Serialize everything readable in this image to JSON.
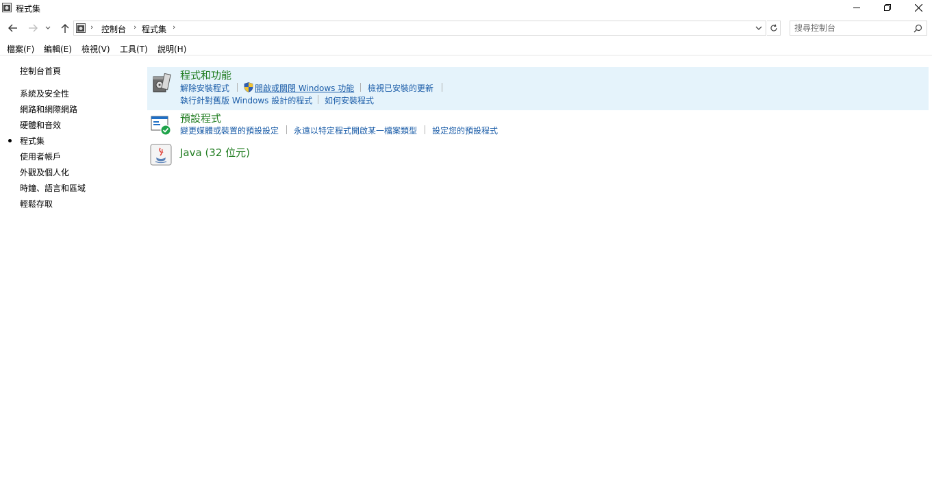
{
  "window": {
    "title": "程式集"
  },
  "address": {
    "crumbs": [
      "控制台",
      "程式集"
    ]
  },
  "search": {
    "placeholder": "搜尋控制台"
  },
  "menu": {
    "items": [
      "檔案(F)",
      "編輯(E)",
      "檢視(V)",
      "工具(T)",
      "說明(H)"
    ]
  },
  "leftnav": {
    "home": "控制台首頁",
    "items": [
      "系統及安全性",
      "網路和網際網路",
      "硬體和音效",
      "程式集",
      "使用者帳戶",
      "外觀及個人化",
      "時鐘、語言和區域",
      "輕鬆存取"
    ],
    "current_index": 3
  },
  "categories": [
    {
      "title": "程式和功能",
      "icon": "programs-features-icon",
      "row1": [
        "解除安裝程式",
        "開啟或關閉 Windows 功能",
        "檢視已安裝的更新"
      ],
      "row2": [
        "執行針對舊版 Windows 設計的程式",
        "如何安裝程式"
      ]
    },
    {
      "title": "預設程式",
      "icon": "default-programs-icon",
      "row1": [
        "變更媒體或裝置的預設設定",
        "永遠以特定程式開啟某一檔案類型",
        "設定您的預設程式"
      ]
    },
    {
      "title": "Java (32 位元)",
      "icon": "java-icon"
    }
  ],
  "colors": {
    "category_title": "#1e7b1e",
    "link": "#1a5ca8",
    "highlight": "#e5f3fb"
  }
}
